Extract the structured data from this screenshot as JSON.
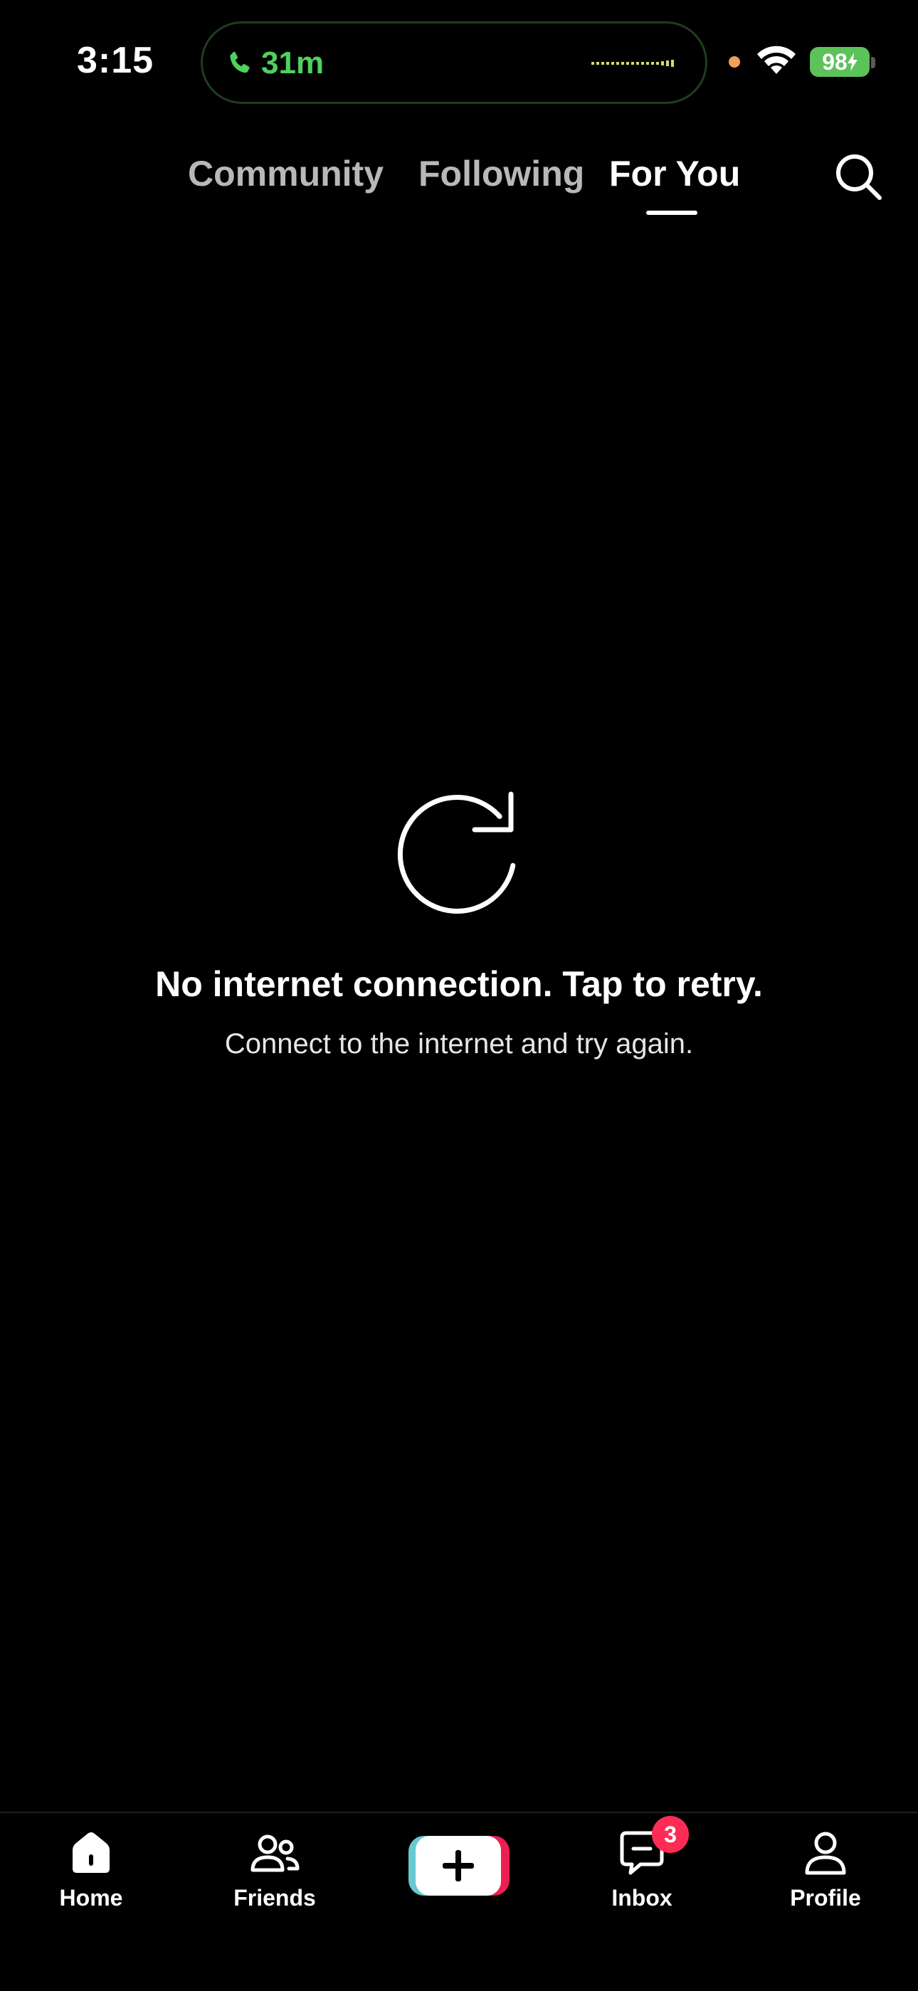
{
  "status_bar": {
    "time": "3:15",
    "call_duration": "31m",
    "battery_level": "98",
    "icons": [
      "phone-icon",
      "waveform-icon",
      "privacy-dot",
      "wifi-icon",
      "battery-icon",
      "charging-bolt-icon"
    ]
  },
  "top_tabs": {
    "items": [
      {
        "label": "Community",
        "selected": false
      },
      {
        "label": "Following",
        "selected": false
      },
      {
        "label": "For You",
        "selected": true
      }
    ],
    "search_icon": "search-icon"
  },
  "error": {
    "icon": "refresh-icon",
    "title": "No internet connection. Tap to retry.",
    "subtitle": "Connect to the internet and try again."
  },
  "bottom_nav": {
    "items": [
      {
        "label": "Home",
        "icon": "home-icon"
      },
      {
        "label": "Friends",
        "icon": "friends-icon"
      },
      {
        "label": "",
        "icon": "plus-icon"
      },
      {
        "label": "Inbox",
        "icon": "inbox-icon",
        "badge": "3"
      },
      {
        "label": "Profile",
        "icon": "profile-icon"
      }
    ]
  },
  "colors": {
    "background": "#000000",
    "call_green": "#4fd15f",
    "battery_green": "#5cc25a",
    "privacy_dot": "#f0a05a",
    "badge_red": "#fe2c55",
    "create_cyan": "#69c9d0",
    "create_red": "#ee1d52",
    "inactive_tab": "#b8b8b8"
  }
}
